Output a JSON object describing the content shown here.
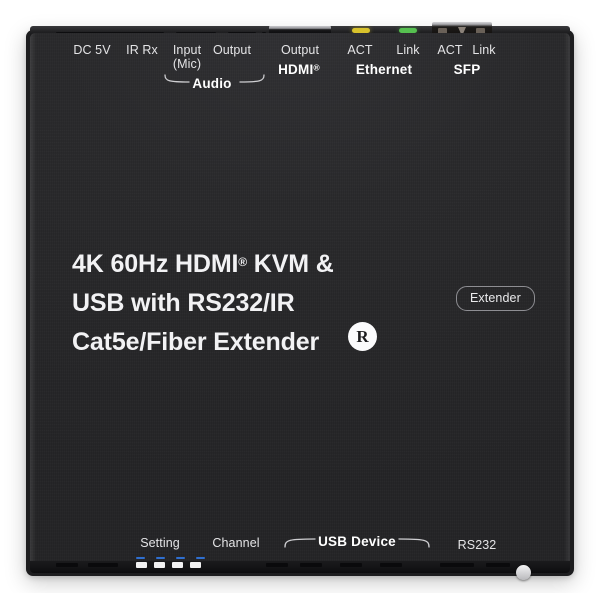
{
  "device": {
    "chassis_color": "#262628",
    "silkscreen_color": "#e4e4e6",
    "accent_led_amber": "#d8c22c",
    "accent_led_green": "#56c050",
    "accent_blue": "#2f6fd0"
  },
  "hero": {
    "line1_a": "4K 60Hz HDMI",
    "line1_reg": "®",
    "line1_b": " KVM &",
    "line2": "USB with RS232/IR",
    "line3": "Cat5e/Fiber Extender",
    "trademark_badge": "R",
    "pill_label": "Extender"
  },
  "top_panel": {
    "labels": [
      {
        "text": "DC 5V",
        "name": "dc-5v"
      },
      {
        "text": "IR Rx",
        "name": "ir-rx"
      },
      {
        "text": "Input",
        "name": "audio-input"
      },
      {
        "text": "(Mic)",
        "name": "audio-input-mic"
      },
      {
        "text": "Output",
        "name": "audio-output"
      },
      {
        "text": "Output",
        "name": "hdmi-output"
      },
      {
        "text": "ACT",
        "name": "ethernet-act"
      },
      {
        "text": "Link",
        "name": "ethernet-link"
      },
      {
        "text": "ACT",
        "name": "sfp-act"
      },
      {
        "text": "Link",
        "name": "sfp-link"
      }
    ],
    "groups": [
      {
        "text": "Audio",
        "reg": "",
        "name": "audio"
      },
      {
        "text": "HDMI",
        "reg": "®",
        "name": "hdmi"
      },
      {
        "text": "Ethernet",
        "reg": "",
        "name": "ethernet"
      },
      {
        "text": "SFP",
        "reg": "",
        "name": "sfp"
      }
    ]
  },
  "bottom_panel": {
    "labels": [
      {
        "text": "Setting",
        "name": "setting"
      },
      {
        "text": "Channel",
        "name": "channel"
      },
      {
        "text": "RS232",
        "name": "rs232"
      }
    ],
    "groups": [
      {
        "text": "USB Device",
        "name": "usb-device"
      }
    ]
  }
}
